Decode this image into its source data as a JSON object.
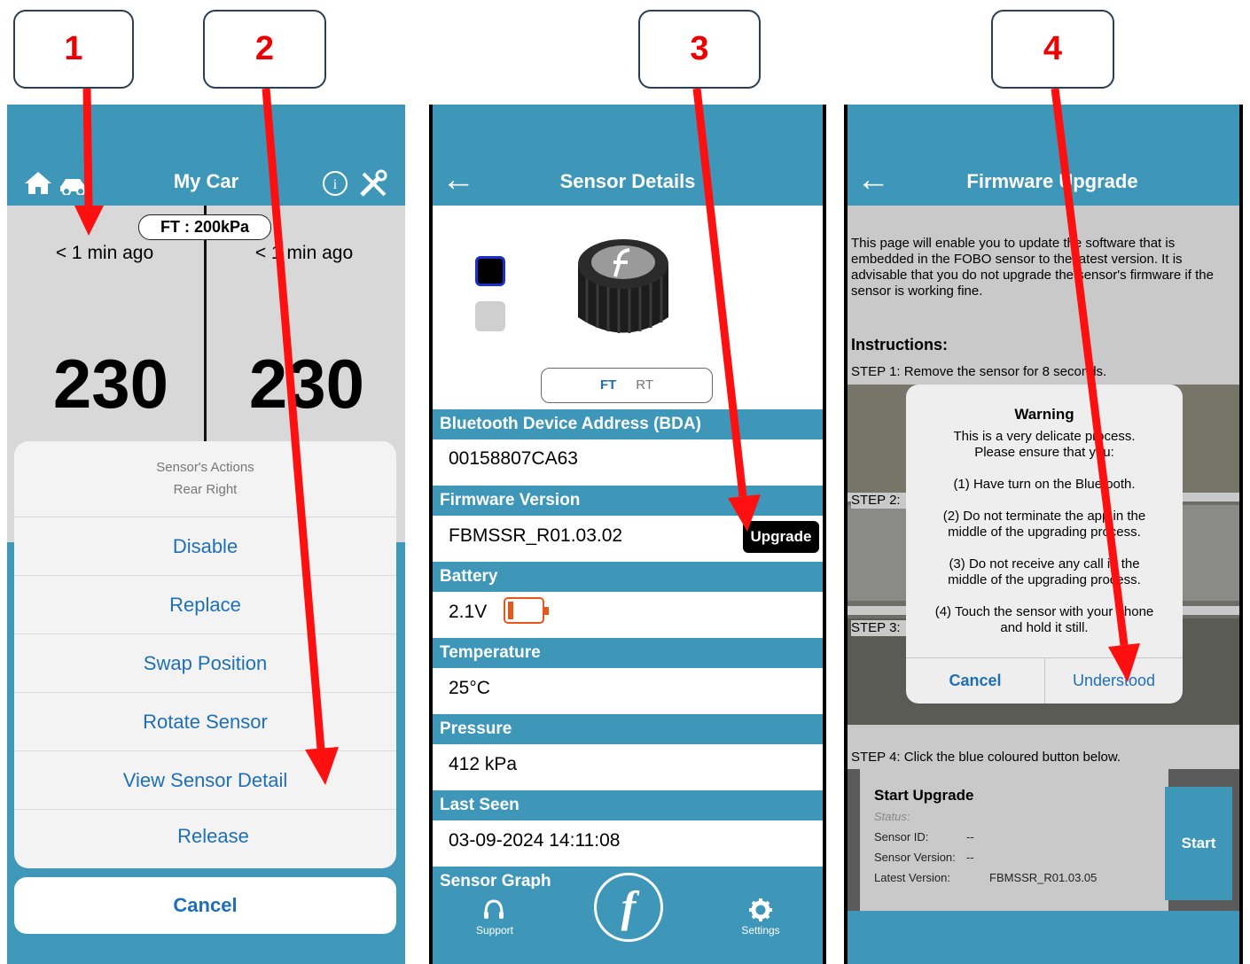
{
  "callouts": [
    "1",
    "2",
    "3",
    "4"
  ],
  "colors": {
    "header": "#3e97b9",
    "arrow": "#ff0000",
    "link": "#1f6fb7",
    "upgrade_btn": "#3e97b9",
    "battery_level": "#e8561c"
  },
  "screen1": {
    "title": "My Car",
    "icons": [
      "home-icon",
      "car-icon",
      "info-icon",
      "tools-icon"
    ],
    "badge": "FT : 200kPa",
    "left_ago": "< 1 min ago",
    "right_ago": "< 1 min ago",
    "left_value": "230",
    "right_value": "230",
    "sheet": {
      "title": "Sensor's Actions",
      "subtitle": "Rear Right",
      "items": [
        "Disable",
        "Replace",
        "Swap Position",
        "Rotate Sensor",
        "View Sensor Detail",
        "Release"
      ],
      "cancel": "Cancel"
    }
  },
  "screen2": {
    "title": "Sensor Details",
    "toggle": {
      "ft": "FT",
      "rt": "RT",
      "selected": "FT"
    },
    "bda_label": "Bluetooth Device Address (BDA)",
    "bda_value": "00158807CA63",
    "fw_label": "Firmware Version",
    "fw_value": "FBMSSR_R01.03.02",
    "upgrade_btn": "Upgrade",
    "battery_label": "Battery",
    "battery_value": "2.1V",
    "battery_level": 0.15,
    "temp_label": "Temperature",
    "temp_value": "25°C",
    "pressure_label": "Pressure",
    "pressure_value": "412 kPa",
    "lastseen_label": "Last Seen",
    "lastseen_value": "03-09-2024 14:11:08",
    "graph_label": "Sensor Graph",
    "nav": {
      "support": "Support",
      "settings": "Settings",
      "logo": "f"
    }
  },
  "screen3": {
    "title": "Firmware Upgrade",
    "intro": "This page will enable you to update the software that is embedded in the FOBO sensor to the latest version. It is advisable that you do not upgrade the sensor's firmware if the sensor is working fine.",
    "instructions": "Instructions:",
    "step1": "STEP 1: Remove the sensor for 8 seconds.",
    "step2": "STEP 2:",
    "step3": "STEP 3:",
    "step4": "STEP 4: Click the blue coloured button below.",
    "dialog": {
      "title": "Warning",
      "line1": "This is a very delicate process.",
      "line2": "Please ensure that you:",
      "item1": "(1) Have turn on the Bluetooth.",
      "item2a": "(2) Do not terminate the app in the",
      "item2b": "middle of the upgrading process.",
      "item3a": "(3) Do not receive any call in the",
      "item3b": "middle of the upgrading process.",
      "item4a": "(4) Touch the sensor with your phone",
      "item4b": "and hold it still.",
      "cancel": "Cancel",
      "ok": "Understood"
    },
    "panel": {
      "title": "Start Upgrade",
      "status": "Status:",
      "sensor_id_label": "Sensor ID:",
      "sensor_id_value": "--",
      "sensor_version_label": "Sensor Version:",
      "sensor_version_value": "--",
      "latest_label": "Latest Version:",
      "latest_value": "FBMSSR_R01.03.05",
      "start": "Start"
    }
  }
}
